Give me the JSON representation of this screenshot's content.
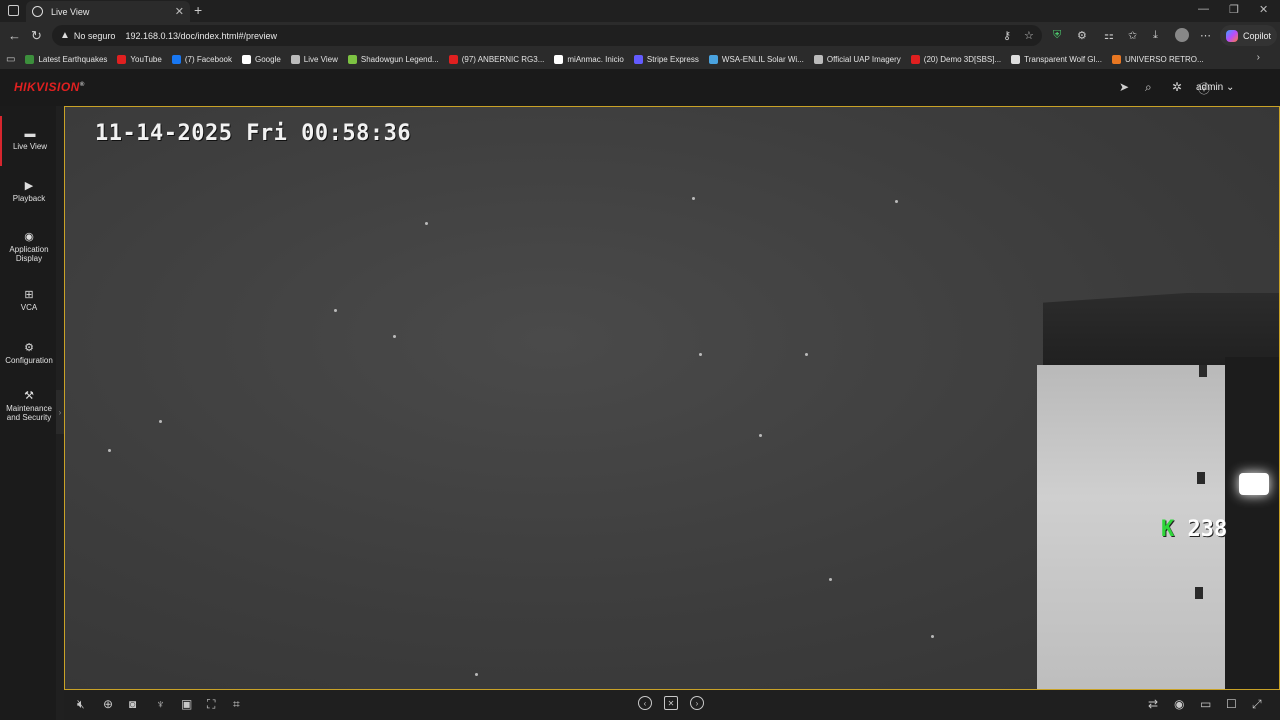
{
  "browser": {
    "tab_title": "Live View",
    "url_warning": "No seguro",
    "url": "192.168.0.13/doc/index.html#/preview",
    "copilot_label": "Copilot",
    "bookmarks": [
      {
        "label": "Latest Earthquakes",
        "color": "#3c8f3c"
      },
      {
        "label": "YouTube",
        "color": "#e02020"
      },
      {
        "label": "(7) Facebook",
        "color": "#1877f2"
      },
      {
        "label": "Google",
        "color": "#ffffff"
      },
      {
        "label": "Live View",
        "color": "#bbbbbb"
      },
      {
        "label": "Shadowgun Legend...",
        "color": "#7cc242"
      },
      {
        "label": "(97) ANBERNIC RG3...",
        "color": "#e02020"
      },
      {
        "label": "miAnmac. Inicio",
        "color": "#ffffff"
      },
      {
        "label": "Stripe Express",
        "color": "#635bff"
      },
      {
        "label": "WSA-ENLIL Solar Wi...",
        "color": "#4aa3df"
      },
      {
        "label": "Official UAP Imagery",
        "color": "#bbbbbb"
      },
      {
        "label": "(20) Demo 3D[SBS]...",
        "color": "#e02020"
      },
      {
        "label": "Transparent Wolf Gl...",
        "color": "#dddddd"
      },
      {
        "label": "UNIVERSO RETRO...",
        "color": "#e87722"
      }
    ]
  },
  "app": {
    "brand": "HIKVISION",
    "brand_mark": "®",
    "user": "admin"
  },
  "nav": [
    {
      "label": "Live View",
      "icon": "monitor-icon"
    },
    {
      "label": "Playback",
      "icon": "playback-icon"
    },
    {
      "label": "Application Display",
      "icon": "application-icon"
    },
    {
      "label": "VCA",
      "icon": "vca-icon"
    },
    {
      "label": "Configuration",
      "icon": "gear-icon"
    },
    {
      "label": "Maintenance and Security",
      "icon": "maintenance-icon"
    }
  ],
  "live": {
    "timestamp": "11-14-2025 Fri 00:58:36",
    "badge_k": "K",
    "badge_num": "238"
  }
}
